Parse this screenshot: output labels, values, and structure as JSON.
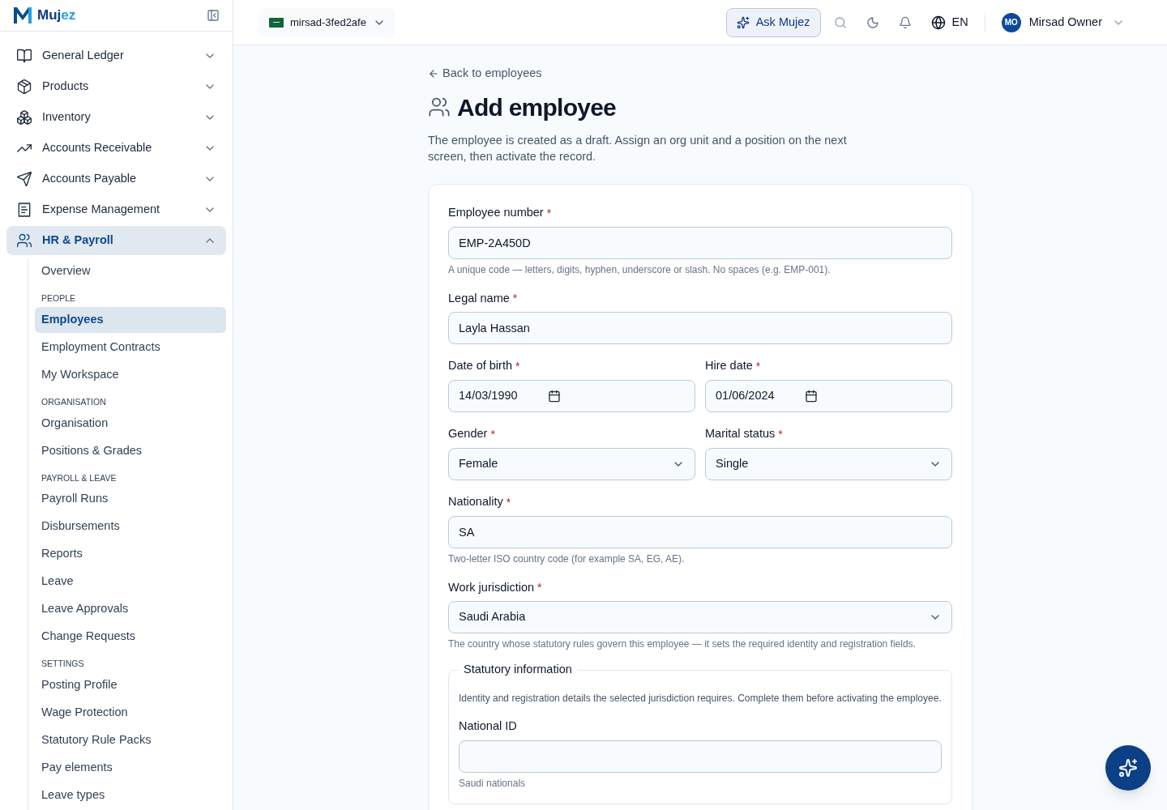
{
  "sidebar": {
    "logo": {
      "dark": "Muj",
      "light": "ez"
    },
    "items": [
      {
        "label": "General Ledger",
        "expanded": false,
        "selected": false
      },
      {
        "label": "Products",
        "expanded": false,
        "selected": false
      },
      {
        "label": "Inventory",
        "expanded": false,
        "selected": false
      },
      {
        "label": "Accounts Receivable",
        "expanded": false,
        "selected": false
      },
      {
        "label": "Accounts Payable",
        "expanded": false,
        "selected": false
      },
      {
        "label": "Expense Management",
        "expanded": false,
        "selected": false
      },
      {
        "label": "HR & Payroll",
        "expanded": true,
        "selected": true,
        "children": [
          {
            "kind": "link",
            "label": "Overview",
            "selected": false
          },
          {
            "kind": "heading",
            "label": "PEOPLE"
          },
          {
            "kind": "link",
            "label": "Employees",
            "selected": true
          },
          {
            "kind": "link",
            "label": "Employment Contracts",
            "selected": false
          },
          {
            "kind": "link",
            "label": "My Workspace",
            "selected": false
          },
          {
            "kind": "heading",
            "label": "ORGANISATION"
          },
          {
            "kind": "link",
            "label": "Organisation",
            "selected": false
          },
          {
            "kind": "link",
            "label": "Positions & Grades",
            "selected": false
          },
          {
            "kind": "heading",
            "label": "PAYROLL & LEAVE"
          },
          {
            "kind": "link",
            "label": "Payroll Runs",
            "selected": false
          },
          {
            "kind": "link",
            "label": "Disbursements",
            "selected": false
          },
          {
            "kind": "link",
            "label": "Reports",
            "selected": false
          },
          {
            "kind": "link",
            "label": "Leave",
            "selected": false
          },
          {
            "kind": "link",
            "label": "Leave Approvals",
            "selected": false
          },
          {
            "kind": "link",
            "label": "Change Requests",
            "selected": false
          },
          {
            "kind": "heading",
            "label": "SETTINGS"
          },
          {
            "kind": "link",
            "label": "Posting Profile",
            "selected": false
          },
          {
            "kind": "link",
            "label": "Wage Protection",
            "selected": false
          },
          {
            "kind": "link",
            "label": "Statutory Rule Packs",
            "selected": false
          },
          {
            "kind": "link",
            "label": "Pay elements",
            "selected": false
          },
          {
            "kind": "link",
            "label": "Leave types",
            "selected": false
          }
        ]
      }
    ]
  },
  "header": {
    "company": "mirsad-3fed2afe",
    "ask_button": "Ask Mujez",
    "language": "EN",
    "user": {
      "initials": "MO",
      "name": "Mirsad Owner"
    }
  },
  "page": {
    "back_link": "Back to employees",
    "title": "Add employee",
    "description": "The employee is created as a draft. Assign an org unit and a position on the next screen, then activate the record.",
    "rows": [
      {
        "fields": [
          {
            "kind": "text",
            "label": "Employee number",
            "required_mark": "*",
            "value": "EMP-2A450D",
            "hint": "A unique code — letters, digits, hyphen, underscore or slash. No spaces (e.g. EMP-001)."
          }
        ]
      },
      {
        "fields": [
          {
            "kind": "text",
            "label": "Legal name",
            "required_mark": "*",
            "value": "Layla Hassan"
          }
        ]
      },
      {
        "fields": [
          {
            "kind": "date",
            "label": "Date of birth",
            "required_mark": "*",
            "value": "14/03/1990"
          },
          {
            "kind": "date",
            "label": "Hire date",
            "required_mark": "*",
            "value": "01/06/2024"
          }
        ]
      },
      {
        "fields": [
          {
            "kind": "select",
            "label": "Gender",
            "required_mark": "*",
            "value": "Female"
          },
          {
            "kind": "select",
            "label": "Marital status",
            "required_mark": "*",
            "value": "Single"
          }
        ]
      },
      {
        "fields": [
          {
            "kind": "text",
            "label": "Nationality",
            "required_mark": "*",
            "value": "SA",
            "hint": "Two-letter ISO country code (for example SA, EG, AE)."
          }
        ]
      },
      {
        "fields": [
          {
            "kind": "select",
            "label": "Work jurisdiction",
            "required_mark": "*",
            "value": "Saudi Arabia",
            "hint": "The country whose statutory rules govern this employee — it sets the required identity and registration fields."
          }
        ]
      }
    ],
    "statutory": {
      "legend": "Statutory information",
      "description": "Identity and registration details the selected jurisdiction requires. Complete them before activating the employee.",
      "fields": [
        {
          "kind": "text",
          "label": "National ID",
          "hint": "Saudi nationals"
        }
      ]
    }
  }
}
